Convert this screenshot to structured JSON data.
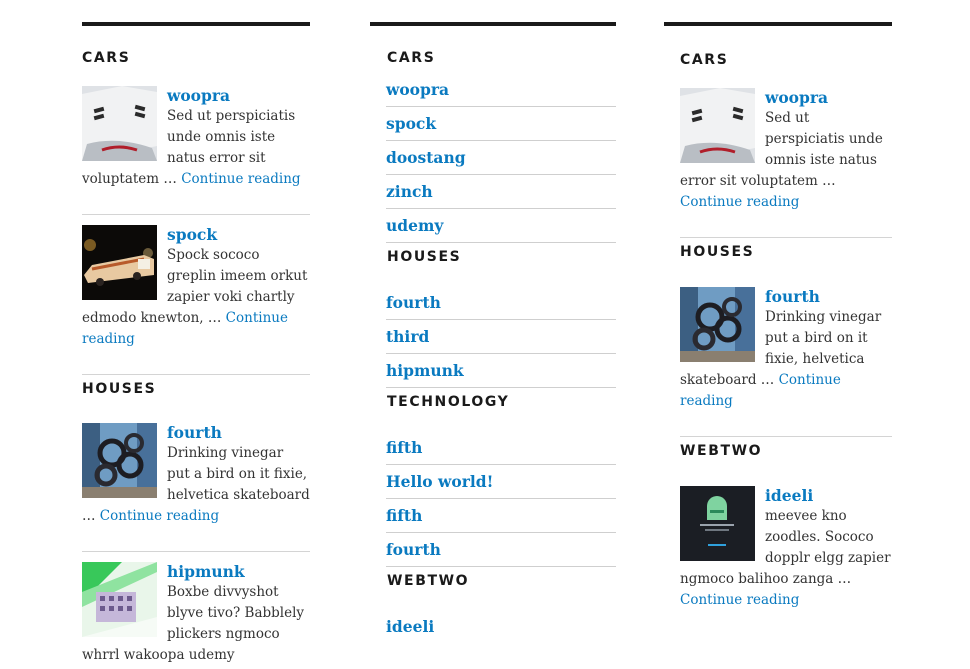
{
  "col1": {
    "cars_heading": "CARS",
    "houses_heading": "HOUSES",
    "posts": [
      {
        "title": "woopra",
        "excerpt": "Sed ut perspiciatis unde omnis iste natus error sit voluptatem …",
        "more": "Continue reading"
      },
      {
        "title": "spock",
        "excerpt": "Spock sococo greplin imeem orkut zapier voki chartly edmodo knewton, …",
        "more": "Continue reading"
      },
      {
        "title": "fourth",
        "excerpt": "Drinking vinegar put a bird on it fixie, helvetica skateboard …",
        "more": "Continue reading"
      },
      {
        "title": "hipmunk",
        "excerpt": "Boxbe divvyshot blyve tivo? Babblely plickers ngmoco whrrl wakoopa udemy"
      }
    ]
  },
  "col2": {
    "sections": [
      {
        "heading": "CARS",
        "items": [
          "woopra",
          "spock",
          "doostang",
          "zinch",
          "udemy"
        ]
      },
      {
        "heading": "HOUSES",
        "items": [
          "fourth",
          "third",
          "hipmunk"
        ]
      },
      {
        "heading": "TECHNOLOGY",
        "items": [
          "fifth",
          "Hello world!",
          "fifth",
          "fourth"
        ]
      },
      {
        "heading": "WEBTWO",
        "items": [
          "ideeli"
        ]
      }
    ]
  },
  "col3": {
    "cars_heading": "CARS",
    "houses_heading": "HOUSES",
    "webtwo_heading": "WEBTWO",
    "posts": [
      {
        "title": "woopra",
        "excerpt": "Sed ut perspiciatis unde omnis iste natus error sit voluptatem …",
        "more": "Continue reading"
      },
      {
        "title": "fourth",
        "excerpt": "Drinking vinegar put a bird on it fixie, helvetica skateboard …",
        "more": "Continue reading"
      },
      {
        "title": "ideeli",
        "excerpt": "meevee kno zoodles. Sococo dopplr elgg zapier ngmoco balihoo zanga …",
        "more": "Continue reading"
      }
    ]
  },
  "colors": {
    "link": "#0a7ac0",
    "heading": "#1a1a1a",
    "text": "#333333",
    "divider": "#d4d4d4"
  }
}
